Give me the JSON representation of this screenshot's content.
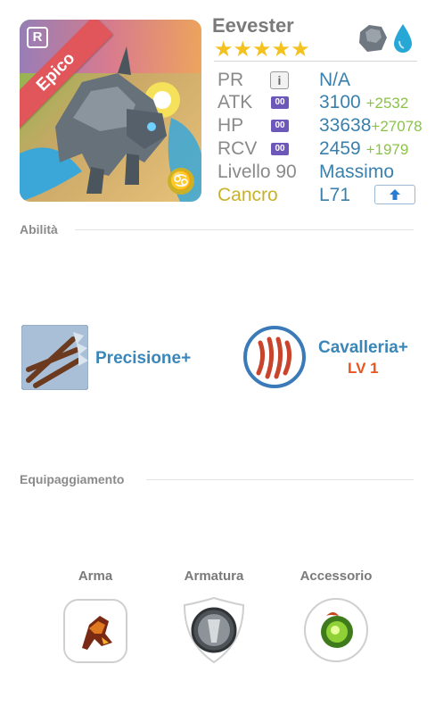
{
  "hero": {
    "name": "Eevester",
    "rarity_label": "Epico",
    "rarity_badge": "R",
    "stars": "★★★★★",
    "zodiac_symbol": "♋",
    "elements": [
      "rock-element-icon",
      "water-element-icon"
    ]
  },
  "stats": {
    "pr": {
      "label": "PR",
      "value": "N/A"
    },
    "atk": {
      "label": "ATK",
      "badge": "00",
      "value": "3100",
      "bonus": "+2532"
    },
    "hp": {
      "label": "HP",
      "badge": "00",
      "value": "33638",
      "bonus": "+27078"
    },
    "rcv": {
      "label": "RCV",
      "badge": "00",
      "value": "2459",
      "bonus": "+1979"
    },
    "level": {
      "label": "Livello 90",
      "value": "Massimo"
    },
    "zodiac": {
      "label": "Cancro",
      "value": "L71"
    }
  },
  "abilities": {
    "title": "Abilità",
    "skill1": {
      "name": "Precisione+"
    },
    "skill2": {
      "name": "Cavalleria+",
      "level": "LV 1"
    }
  },
  "equipment": {
    "title": "Equipaggiamento",
    "weapon": "Arma",
    "armor": "Armatura",
    "accessory": "Accessorio"
  },
  "colors": {
    "stat_value": "#3a80ad",
    "bonus": "#8bc34a",
    "zodiac": "#c9b22a",
    "ribbon": "#e0565a",
    "skill_name": "#3b86b8",
    "skill_level": "#e8551e"
  }
}
